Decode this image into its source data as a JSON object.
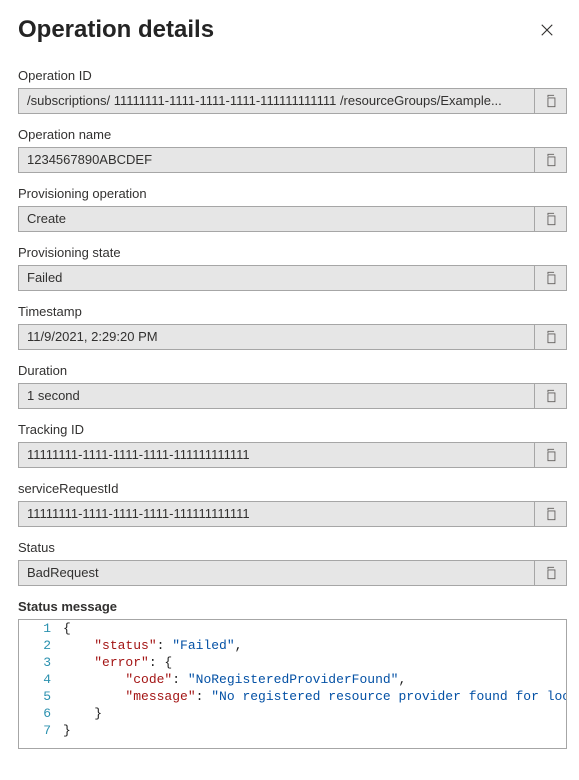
{
  "header": {
    "title": "Operation details"
  },
  "fields": {
    "operationId": {
      "label": "Operation ID",
      "value": "/subscriptions/ 11111111-1111-1111-1111-111111111111 /resourceGroups/Example..."
    },
    "operationName": {
      "label": "Operation name",
      "value": "1234567890ABCDEF"
    },
    "provisioningOperation": {
      "label": "Provisioning operation",
      "value": "Create"
    },
    "provisioningState": {
      "label": "Provisioning state",
      "value": "Failed"
    },
    "timestamp": {
      "label": "Timestamp",
      "value": "11/9/2021, 2:29:20 PM"
    },
    "duration": {
      "label": "Duration",
      "value": "1 second"
    },
    "trackingId": {
      "label": "Tracking ID",
      "value": "11111111-1111-1111-1111-111111111111"
    },
    "serviceRequestId": {
      "label": "serviceRequestId",
      "value": "11111111-1111-1111-1111-111111111111"
    },
    "status": {
      "label": "Status",
      "value": "BadRequest"
    }
  },
  "statusMessage": {
    "label": "Status message",
    "json": {
      "status": "Failed",
      "error": {
        "code": "NoRegisteredProviderFound",
        "message": "No registered resource provider found for location 'centralus' and API version '0000-00-00' for type 'servers'."
      }
    },
    "lines": [
      "{",
      "    \"status\": \"Failed\",",
      "    \"error\": {",
      "        \"code\": \"NoRegisteredProviderFound\",",
      "        \"message\": \"No registered resource provider found for location 'centralus' and API version '0000-00-00' for type 'servers'.\"",
      "    }",
      "}"
    ]
  }
}
